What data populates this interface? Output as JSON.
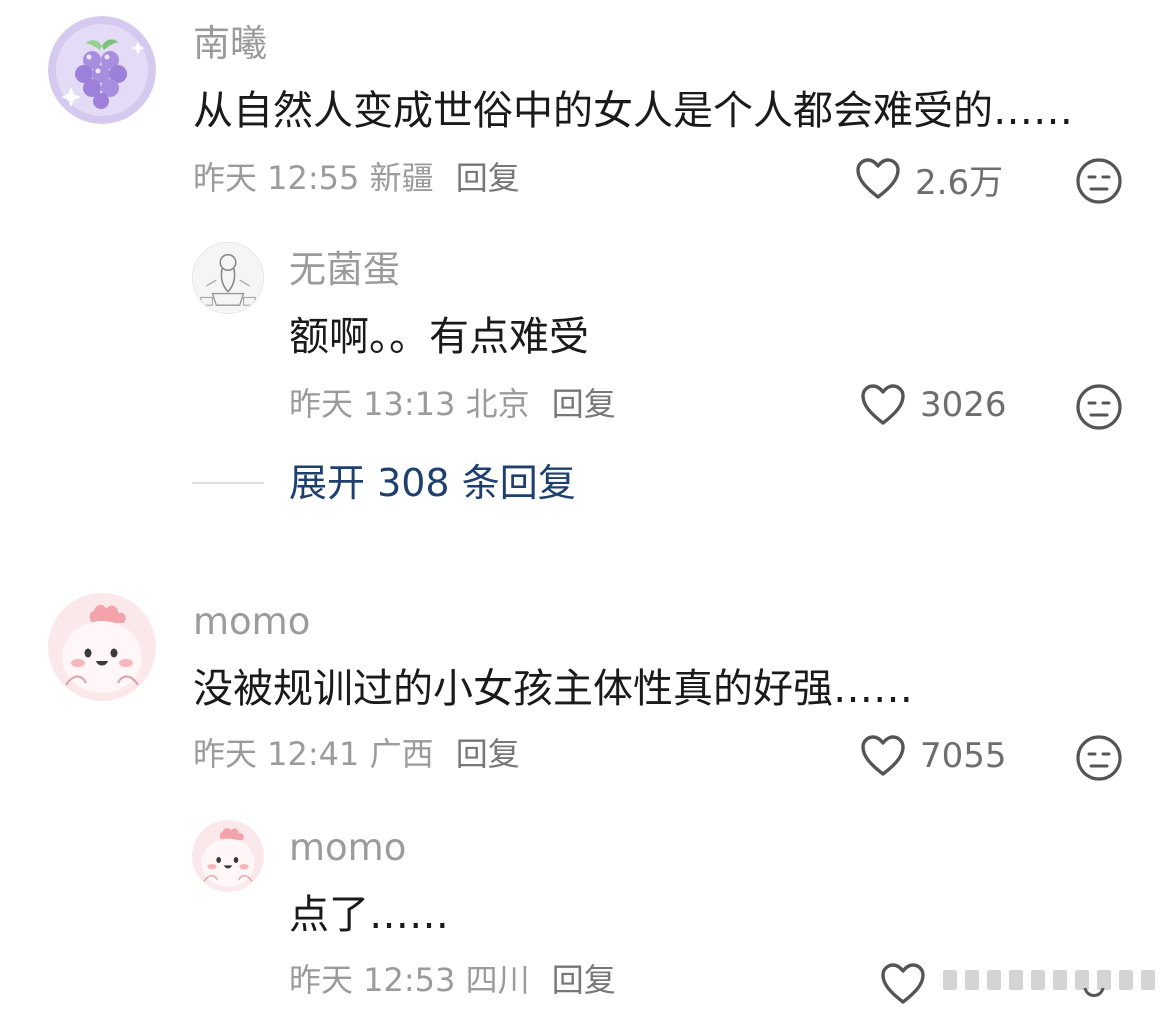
{
  "comments": [
    {
      "username": "南曦",
      "text": "从自然人变成世俗中的女人是个人都会难受的……",
      "time": "昨天 12:55",
      "location": "新疆",
      "reply_label": "回复",
      "likes": "2.6万",
      "avatar_icon": "grape-icon"
    },
    {
      "username": "无菌蛋",
      "text": "额啊。。有点难受",
      "time": "昨天 13:13",
      "location": "北京",
      "reply_label": "回复",
      "likes": "3026",
      "avatar_icon": "sketch-figure-icon"
    },
    {
      "username": "momo",
      "text": "没被规训过的小女孩主体性真的好强……",
      "time": "昨天 12:41",
      "location": "广西",
      "reply_label": "回复",
      "likes": "7055",
      "avatar_icon": "pink-blob-icon"
    },
    {
      "username": "momo",
      "text": "点了……",
      "time": "昨天 12:53",
      "location": "四川",
      "reply_label": "回复",
      "likes": "",
      "avatar_icon": "pink-blob-icon"
    }
  ],
  "expand_replies": {
    "label": "展开 308 条回复"
  },
  "colors": {
    "username": "#9b9b9b",
    "body": "#1a1a1a",
    "expand_link": "#1f3f6e",
    "avatar_purple": "#d9ccf2",
    "avatar_pink": "#fbe3e5"
  }
}
